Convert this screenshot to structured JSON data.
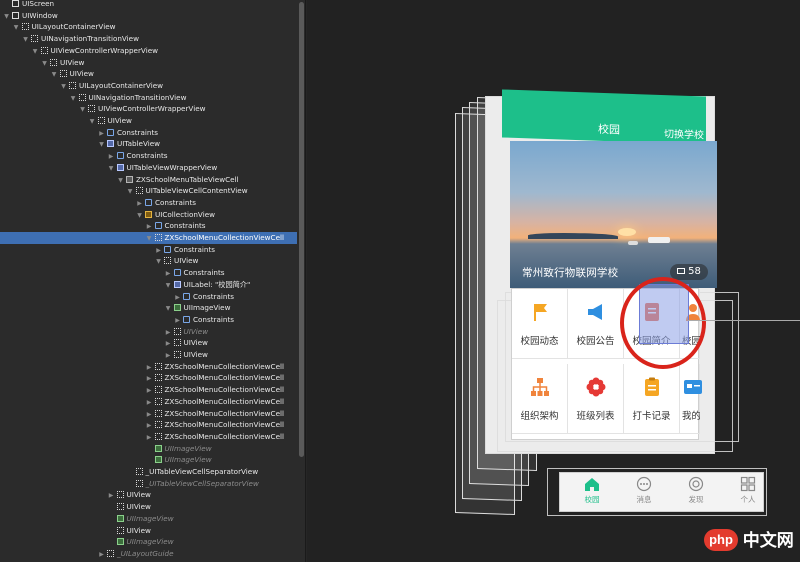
{
  "outline": {
    "rows": [
      {
        "label": "UIScreen",
        "depth": 0,
        "disclosure": "",
        "icon": "s"
      },
      {
        "label": "UIWindow",
        "depth": 0,
        "disclosure": "▼",
        "icon": "s"
      },
      {
        "label": "UILayoutContainerView",
        "depth": 1,
        "disclosure": "▼",
        "icon": ""
      },
      {
        "label": "UINavigationTransitionView",
        "depth": 2,
        "disclosure": "▼",
        "icon": ""
      },
      {
        "label": "UIViewControllerWrapperView",
        "depth": 3,
        "disclosure": "▼",
        "icon": ""
      },
      {
        "label": "UIView",
        "depth": 4,
        "disclosure": "▼",
        "icon": ""
      },
      {
        "label": "UIView",
        "depth": 5,
        "disclosure": "▼",
        "icon": ""
      },
      {
        "label": "UILayoutContainerView",
        "depth": 6,
        "disclosure": "▼",
        "icon": ""
      },
      {
        "label": "UINavigationTransitionView",
        "depth": 7,
        "disclosure": "▼",
        "icon": ""
      },
      {
        "label": "UIViewControllerWrapperView",
        "depth": 8,
        "disclosure": "▼",
        "icon": ""
      },
      {
        "label": "UIView",
        "depth": 9,
        "disclosure": "▼",
        "icon": ""
      },
      {
        "label": "Constraints",
        "depth": 10,
        "disclosure": "▶",
        "icon": "c"
      },
      {
        "label": "UITableView",
        "depth": 10,
        "disclosure": "▼",
        "icon": "t"
      },
      {
        "label": "Constraints",
        "depth": 11,
        "disclosure": "▶",
        "icon": "c"
      },
      {
        "label": "UITableViewWrapperView",
        "depth": 11,
        "disclosure": "▼",
        "icon": "t"
      },
      {
        "label": "ZXSchoolMenuTableViewCell",
        "depth": 12,
        "disclosure": "▼",
        "icon": "l"
      },
      {
        "label": "UITableViewCellContentView",
        "depth": 13,
        "disclosure": "▼",
        "icon": ""
      },
      {
        "label": "Constraints",
        "depth": 14,
        "disclosure": "▶",
        "icon": "c"
      },
      {
        "label": "UICollectionView",
        "depth": 14,
        "disclosure": "▼",
        "icon": "o"
      },
      {
        "label": "Constraints",
        "depth": 15,
        "disclosure": "▶",
        "icon": "c"
      },
      {
        "label": "ZXSchoolMenuCollectionViewCell",
        "depth": 15,
        "disclosure": "▼",
        "icon": "",
        "selected": true
      },
      {
        "label": "Constraints",
        "depth": 16,
        "disclosure": "▶",
        "icon": "c"
      },
      {
        "label": "UIView",
        "depth": 16,
        "disclosure": "▼",
        "icon": ""
      },
      {
        "label": "Constraints",
        "depth": 17,
        "disclosure": "▶",
        "icon": "c"
      },
      {
        "label": "UILabel: \"校园简介\"",
        "depth": 17,
        "disclosure": "▼",
        "icon": "t"
      },
      {
        "label": "Constraints",
        "depth": 18,
        "disclosure": "▶",
        "icon": "c"
      },
      {
        "label": "UIImageView",
        "depth": 17,
        "disclosure": "▼",
        "icon": "i"
      },
      {
        "label": "Constraints",
        "depth": 18,
        "disclosure": "▶",
        "icon": "c"
      },
      {
        "label": "UIView",
        "depth": 17,
        "disclosure": "▶",
        "icon": "",
        "dim": true
      },
      {
        "label": "UIView",
        "depth": 17,
        "disclosure": "▶",
        "icon": ""
      },
      {
        "label": "UIView",
        "depth": 17,
        "disclosure": "▶",
        "icon": ""
      },
      {
        "label": "ZXSchoolMenuCollectionViewCell",
        "depth": 15,
        "disclosure": "▶",
        "icon": ""
      },
      {
        "label": "ZXSchoolMenuCollectionViewCell",
        "depth": 15,
        "disclosure": "▶",
        "icon": ""
      },
      {
        "label": "ZXSchoolMenuCollectionViewCell",
        "depth": 15,
        "disclosure": "▶",
        "icon": ""
      },
      {
        "label": "ZXSchoolMenuCollectionViewCell",
        "depth": 15,
        "disclosure": "▶",
        "icon": ""
      },
      {
        "label": "ZXSchoolMenuCollectionViewCell",
        "depth": 15,
        "disclosure": "▶",
        "icon": ""
      },
      {
        "label": "ZXSchoolMenuCollectionViewCell",
        "depth": 15,
        "disclosure": "▶",
        "icon": ""
      },
      {
        "label": "ZXSchoolMenuCollectionViewCell",
        "depth": 15,
        "disclosure": "▶",
        "icon": ""
      },
      {
        "label": "UIImageView",
        "depth": 15,
        "disclosure": "",
        "icon": "i",
        "dim": true
      },
      {
        "label": "UIImageView",
        "depth": 15,
        "disclosure": "",
        "icon": "i",
        "dim": true
      },
      {
        "label": "_UITableViewCellSeparatorView",
        "depth": 13,
        "disclosure": "",
        "icon": ""
      },
      {
        "label": "_UITableViewCellSeparatorView",
        "depth": 13,
        "disclosure": "",
        "icon": "",
        "dim": true
      },
      {
        "label": "UIView",
        "depth": 11,
        "disclosure": "▶",
        "icon": ""
      },
      {
        "label": "UIView",
        "depth": 11,
        "disclosure": "",
        "icon": ""
      },
      {
        "label": "UIImageView",
        "depth": 11,
        "disclosure": "",
        "icon": "i",
        "dim": true
      },
      {
        "label": "UIView",
        "depth": 11,
        "disclosure": "",
        "icon": ""
      },
      {
        "label": "UIImageView",
        "depth": 11,
        "disclosure": "",
        "icon": "i",
        "dim": true
      },
      {
        "label": "_UILayoutGuide",
        "depth": 10,
        "disclosure": "▶",
        "icon": "",
        "dim": true
      }
    ]
  },
  "app": {
    "nav_title": "校园",
    "nav_switch": "切换学校",
    "banner_caption": "常州致行物联网学校",
    "photo_count": "58",
    "menu": [
      {
        "label": "校园动态",
        "icon": "flag-icon",
        "color": "#f5a623"
      },
      {
        "label": "校园公告",
        "icon": "megaphone-icon",
        "color": "#2f8fe0"
      },
      {
        "label": "校园简介",
        "icon": "document-icon",
        "color": "#f0643c"
      },
      {
        "label": "校园风采",
        "icon": "person-icon",
        "color": "#f0843c"
      },
      {
        "label": "组织架构",
        "icon": "org-chart-icon",
        "color": "#f0843c"
      },
      {
        "label": "班级列表",
        "icon": "flower-icon",
        "color": "#e53935"
      },
      {
        "label": "打卡记录",
        "icon": "clipboard-icon",
        "color": "#f5a623"
      },
      {
        "label": "我的IC卡",
        "icon": "ic-card-icon",
        "color": "#2f8fe0"
      }
    ],
    "tabs": [
      {
        "label": "校园",
        "icon": "home-icon",
        "active": true
      },
      {
        "label": "消息",
        "icon": "chat-icon"
      },
      {
        "label": "发现",
        "icon": "compass-icon"
      },
      {
        "label": "个人",
        "icon": "grid-icon"
      }
    ]
  },
  "watermark": {
    "badge": "php",
    "text": "中文网"
  },
  "colors": {
    "brand": "#1dbf8a",
    "selection": "#3e6fb3",
    "ring": "#d9241b"
  }
}
